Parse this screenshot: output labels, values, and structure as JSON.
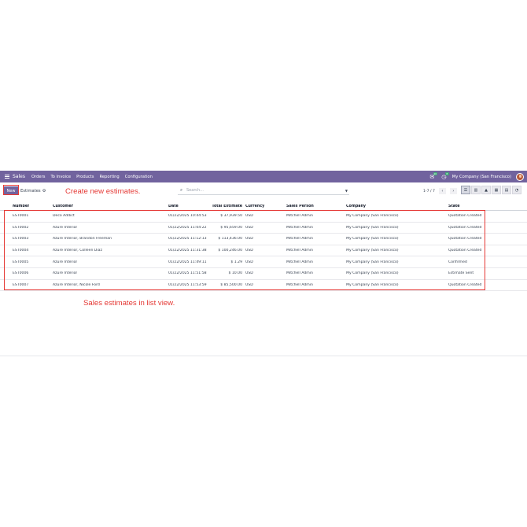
{
  "navbar": {
    "app_name": "Sales",
    "menu": [
      "Orders",
      "To Invoice",
      "Products",
      "Reporting",
      "Configuration"
    ],
    "chat_badge": "10",
    "activity_badge": "8",
    "company": "My Company (San Francisco)"
  },
  "control": {
    "new_label": "New",
    "breadcrumb": "Estimates",
    "search_placeholder": "Search...",
    "pager": "1-7 / 7"
  },
  "table": {
    "headers": [
      "Number",
      "Customer",
      "Date",
      "Total Estimate",
      "Currency",
      "Sales Person",
      "Company",
      "State"
    ],
    "rows": [
      [
        "EST0001",
        "Deco Addict",
        "01/22/2025 10:44:53",
        "$ 37,939.50",
        "USD",
        "Mitchell Admin",
        "My Company (San Francisco)",
        "Quotation Created"
      ],
      [
        "EST0002",
        "Azure Interior",
        "01/22/2025 11:04:22",
        "$ 95,659.00",
        "USD",
        "Mitchell Admin",
        "My Company (San Francisco)",
        "Quotation Created"
      ],
      [
        "EST0003",
        "Azure Interior, Brandon Freeman",
        "01/22/2025 11:12:13",
        "$ 113,436.00",
        "USD",
        "Mitchell Admin",
        "My Company (San Francisco)",
        "Quotation Created"
      ],
      [
        "EST0004",
        "Azure Interior, Colleen Diaz",
        "01/22/2025 11:31:38",
        "$ 100,246.00",
        "USD",
        "Mitchell Admin",
        "My Company (San Francisco)",
        "Quotation Created"
      ],
      [
        "EST0005",
        "Azure Interior",
        "01/22/2025 11:49:11",
        "$ 1.29",
        "USD",
        "Mitchell Admin",
        "My Company (San Francisco)",
        "Confirmed"
      ],
      [
        "EST0006",
        "Azure Interior",
        "01/22/2025 11:51:58",
        "$ 10.00",
        "USD",
        "Mitchell Admin",
        "My Company (San Francisco)",
        "Estimate Sent"
      ],
      [
        "EST0007",
        "Azure Interior, Nicole Ford",
        "01/22/2025 11:53:59",
        "$ 85,500.00",
        "USD",
        "Mitchell Admin",
        "My Company (San Francisco)",
        "Quotation Created"
      ]
    ]
  },
  "annotations": {
    "new_note": "Create new estimates.",
    "list_note": "Sales estimates in list view."
  },
  "colors": {
    "brand": "#71639e",
    "highlight": "#e53935"
  }
}
